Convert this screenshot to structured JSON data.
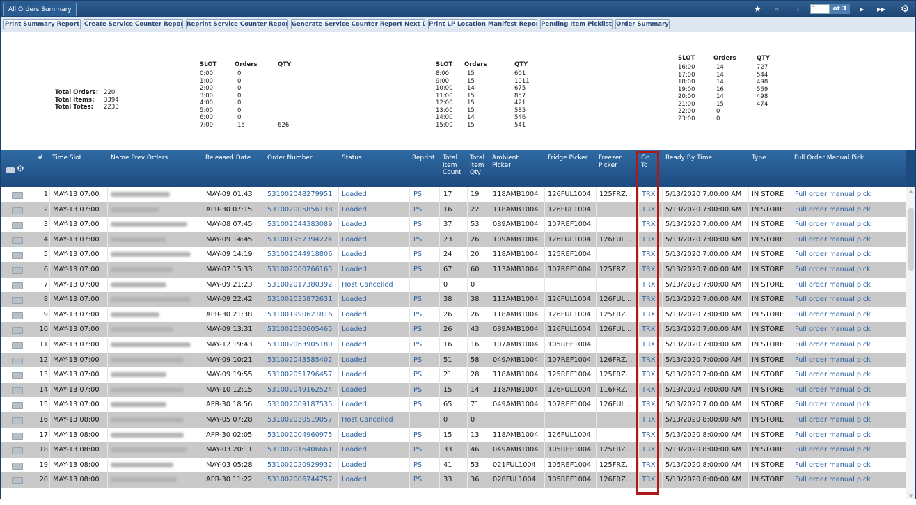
{
  "window": {
    "tab_title": "All Orders Summary"
  },
  "pager": {
    "current_page": "1",
    "of_label": "of 3"
  },
  "toolbar": {
    "buttons": [
      "Print Summary Report",
      "Create Service Counter Report",
      "Reprint Service Counter Report",
      "Generate Service Counter Report Next Day",
      "Print LP Location Manifest Report",
      "Pending Item Picklist",
      "Order Summary"
    ]
  },
  "totals": {
    "orders_label": "Total Orders:",
    "orders": "220",
    "items_label": "Total Items:",
    "items": "3394",
    "totes_label": "Total Totes:",
    "totes": "2233"
  },
  "slot_headers": {
    "slot": "SLOT",
    "orders": "Orders",
    "qty": "QTY"
  },
  "slot_groups": [
    [
      [
        "0:00",
        "0",
        ""
      ],
      [
        "1:00",
        "0",
        ""
      ],
      [
        "2:00",
        "0",
        ""
      ],
      [
        "3:00",
        "0",
        ""
      ],
      [
        "4:00",
        "0",
        ""
      ],
      [
        "5:00",
        "0",
        ""
      ],
      [
        "6:00",
        "0",
        ""
      ],
      [
        "7:00",
        "15",
        "626"
      ]
    ],
    [
      [
        "8:00",
        "15",
        "601"
      ],
      [
        "9:00",
        "15",
        "1011"
      ],
      [
        "10:00",
        "14",
        "675"
      ],
      [
        "11:00",
        "15",
        "857"
      ],
      [
        "12:00",
        "15",
        "421"
      ],
      [
        "13:00",
        "15",
        "585"
      ],
      [
        "14:00",
        "14",
        "546"
      ],
      [
        "15:00",
        "15",
        "541"
      ]
    ],
    [
      [
        "16:00",
        "14",
        "727"
      ],
      [
        "17:00",
        "14",
        "544"
      ],
      [
        "18:00",
        "14",
        "498"
      ],
      [
        "19:00",
        "16",
        "569"
      ],
      [
        "20:00",
        "14",
        "498"
      ],
      [
        "21:00",
        "15",
        "474"
      ],
      [
        "22:00",
        "0",
        ""
      ],
      [
        "23:00",
        "0",
        ""
      ]
    ]
  ],
  "columns": {
    "num": "#",
    "time_slot": "Time Slot",
    "name": "Name Prev Orders",
    "released": "Released Date",
    "order": "Order Number",
    "status": "Status",
    "reprint": "Reprint",
    "total_item_count": "Total Item Count",
    "total_item_qty": "Total Item Qty",
    "ambient": "Ambient Picker",
    "fridge": "Fridge Picker",
    "freezer": "Freezer Picker",
    "goto": "Go To",
    "ready": "Ready By Time",
    "type": "Type",
    "manual": "Full Order Manual Pick"
  },
  "rows": [
    {
      "n": "1",
      "slot": "MAY-13 07:00",
      "rel": "MAY-09 01:43",
      "order": "531002048279951",
      "status": "Loaded",
      "reprint": "PS",
      "count": "17",
      "qty": "19",
      "amb": "118AMB1004",
      "fri": "126FUL1004",
      "fre": "125FRZ...",
      "goto": "TRX",
      "ready": "5/13/2020 7:00:00 AM",
      "type": "IN STORE",
      "manual": "Full order manual pick",
      "bw": 85
    },
    {
      "n": "2",
      "slot": "MAY-13 07:00",
      "rel": "APR-30 07:15",
      "order": "531002005856138",
      "status": "Loaded",
      "reprint": "PS",
      "count": "16",
      "qty": "22",
      "amb": "118AMB1004",
      "fri": "126FUL1004",
      "fre": "",
      "goto": "TRX",
      "ready": "5/13/2020 7:00:00 AM",
      "type": "IN STORE",
      "manual": "Full order manual pick",
      "bw": 70
    },
    {
      "n": "3",
      "slot": "MAY-13 07:00",
      "rel": "MAY-08 07:45",
      "order": "531002044383089",
      "status": "Loaded",
      "reprint": "PS",
      "count": "37",
      "qty": "53",
      "amb": "089AMB1004",
      "fri": "107REF1004",
      "fre": "",
      "goto": "TRX",
      "ready": "5/13/2020 7:00:00 AM",
      "type": "IN STORE",
      "manual": "Full order manual pick",
      "bw": 110
    },
    {
      "n": "4",
      "slot": "MAY-13 07:00",
      "rel": "MAY-09 14:45",
      "order": "531001957394224",
      "status": "Loaded",
      "reprint": "PS",
      "count": "23",
      "qty": "26",
      "amb": "109AMB1004",
      "fri": "126FUL1004",
      "fre": "126FUL...",
      "goto": "TRX",
      "ready": "5/13/2020 7:00:00 AM",
      "type": "IN STORE",
      "manual": "Full order manual pick",
      "bw": 80
    },
    {
      "n": "5",
      "slot": "MAY-13 07:00",
      "rel": "MAY-09 14:19",
      "order": "531002044918806",
      "status": "Loaded",
      "reprint": "PS",
      "count": "24",
      "qty": "20",
      "amb": "118AMB1004",
      "fri": "125REF1004",
      "fre": "",
      "goto": "TRX",
      "ready": "5/13/2020 7:00:00 AM",
      "type": "IN STORE",
      "manual": "Full order manual pick",
      "bw": 115
    },
    {
      "n": "6",
      "slot": "MAY-13 07:00",
      "rel": "MAY-07 15:33",
      "order": "531002000766165",
      "status": "Loaded",
      "reprint": "PS",
      "count": "67",
      "qty": "60",
      "amb": "113AMB1004",
      "fri": "107REF1004",
      "fre": "125FRZ...",
      "goto": "TRX",
      "ready": "5/13/2020 7:00:00 AM",
      "type": "IN STORE",
      "manual": "Full order manual pick",
      "bw": 90
    },
    {
      "n": "7",
      "slot": "MAY-13 07:00",
      "rel": "MAY-09 21:23",
      "order": "531002017380392",
      "status": "Host Cancelled",
      "reprint": "",
      "count": "0",
      "qty": "0",
      "amb": "",
      "fri": "",
      "fre": "",
      "goto": "TRX",
      "ready": "5/13/2020 7:00:00 AM",
      "type": "IN STORE",
      "manual": "Full order manual pick",
      "bw": 80
    },
    {
      "n": "8",
      "slot": "MAY-13 07:00",
      "rel": "MAY-09 22:42",
      "order": "531002035872631",
      "status": "Loaded",
      "reprint": "PS",
      "count": "38",
      "qty": "38",
      "amb": "113AMB1004",
      "fri": "126FUL1004",
      "fre": "126FUL...",
      "goto": "TRX",
      "ready": "5/13/2020 7:00:00 AM",
      "type": "IN STORE",
      "manual": "Full order manual pick",
      "bw": 115
    },
    {
      "n": "9",
      "slot": "MAY-13 07:00",
      "rel": "APR-30 21:38",
      "order": "531001990621816",
      "status": "Loaded",
      "reprint": "PS",
      "count": "26",
      "qty": "26",
      "amb": "118AMB1004",
      "fri": "126FUL1004",
      "fre": "125FRZ...",
      "goto": "TRX",
      "ready": "5/13/2020 7:00:00 AM",
      "type": "IN STORE",
      "manual": "Full order manual pick",
      "bw": 70
    },
    {
      "n": "10",
      "slot": "MAY-13 07:00",
      "rel": "MAY-09 13:31",
      "order": "531002030605465",
      "status": "Loaded",
      "reprint": "PS",
      "count": "26",
      "qty": "43",
      "amb": "089AMB1004",
      "fri": "126FUL1004",
      "fre": "126FUL...",
      "goto": "TRX",
      "ready": "5/13/2020 7:00:00 AM",
      "type": "IN STORE",
      "manual": "Full order manual pick",
      "bw": 90
    },
    {
      "n": "11",
      "slot": "MAY-13 07:00",
      "rel": "MAY-12 19:43",
      "order": "531002063905180",
      "status": "Loaded",
      "reprint": "PS",
      "count": "16",
      "qty": "16",
      "amb": "107AMB1004",
      "fri": "105REF1004",
      "fre": "",
      "goto": "TRX",
      "ready": "5/13/2020 7:00:00 AM",
      "type": "IN STORE",
      "manual": "Full order manual pick",
      "bw": 115
    },
    {
      "n": "12",
      "slot": "MAY-13 07:00",
      "rel": "MAY-09 10:21",
      "order": "531002043585402",
      "status": "Loaded",
      "reprint": "PS",
      "count": "51",
      "qty": "58",
      "amb": "049AMB1004",
      "fri": "107REF1004",
      "fre": "126FRZ...",
      "goto": "TRX",
      "ready": "5/13/2020 7:00:00 AM",
      "type": "IN STORE",
      "manual": "Full order manual pick",
      "bw": 105
    },
    {
      "n": "13",
      "slot": "MAY-13 07:00",
      "rel": "MAY-09 19:55",
      "order": "531002051796457",
      "status": "Loaded",
      "reprint": "PS",
      "count": "21",
      "qty": "28",
      "amb": "118AMB1004",
      "fri": "125REF1004",
      "fre": "125FRZ...",
      "goto": "TRX",
      "ready": "5/13/2020 7:00:00 AM",
      "type": "IN STORE",
      "manual": "Full order manual pick",
      "bw": 80
    },
    {
      "n": "14",
      "slot": "MAY-13 07:00",
      "rel": "MAY-10 12:15",
      "order": "531002049162524",
      "status": "Loaded",
      "reprint": "PS",
      "count": "15",
      "qty": "14",
      "amb": "118AMB1004",
      "fri": "126FUL1004",
      "fre": "116FRZ...",
      "goto": "TRX",
      "ready": "5/13/2020 7:00:00 AM",
      "type": "IN STORE",
      "manual": "Full order manual pick",
      "bw": 105
    },
    {
      "n": "15",
      "slot": "MAY-13 07:00",
      "rel": "APR-30 18:56",
      "order": "531002009187535",
      "status": "Loaded",
      "reprint": "PS",
      "count": "65",
      "qty": "71",
      "amb": "049AMB1004",
      "fri": "107REF1004",
      "fre": "126FUL...",
      "goto": "TRX",
      "ready": "5/13/2020 7:00:00 AM",
      "type": "IN STORE",
      "manual": "Full order manual pick",
      "bw": 80
    },
    {
      "n": "16",
      "slot": "MAY-13 08:00",
      "rel": "MAY-05 07:28",
      "order": "531002030519057",
      "status": "Host Cancelled",
      "reprint": "",
      "count": "0",
      "qty": "0",
      "amb": "",
      "fri": "",
      "fre": "",
      "goto": "TRX",
      "ready": "5/13/2020 8:00:00 AM",
      "type": "IN STORE",
      "manual": "Full order manual pick",
      "bw": 105
    },
    {
      "n": "17",
      "slot": "MAY-13 08:00",
      "rel": "APR-30 02:05",
      "order": "531002004960975",
      "status": "Loaded",
      "reprint": "PS",
      "count": "15",
      "qty": "13",
      "amb": "118AMB1004",
      "fri": "126FUL1004",
      "fre": "",
      "goto": "TRX",
      "ready": "5/13/2020 8:00:00 AM",
      "type": "IN STORE",
      "manual": "Full order manual pick",
      "bw": 105
    },
    {
      "n": "18",
      "slot": "MAY-13 08:00",
      "rel": "MAY-03 20:11",
      "order": "531002016406661",
      "status": "Loaded",
      "reprint": "PS",
      "count": "33",
      "qty": "46",
      "amb": "049AMB1004",
      "fri": "105REF1004",
      "fre": "125FRZ...",
      "goto": "TRX",
      "ready": "5/13/2020 8:00:00 AM",
      "type": "IN STORE",
      "manual": "Full order manual pick",
      "bw": 110
    },
    {
      "n": "19",
      "slot": "MAY-13 08:00",
      "rel": "MAY-03 05:28",
      "order": "531002020929932",
      "status": "Loaded",
      "reprint": "PS",
      "count": "41",
      "qty": "53",
      "amb": "021FUL1004",
      "fri": "105REF1004",
      "fre": "125FRZ...",
      "goto": "TRX",
      "ready": "5/13/2020 8:00:00 AM",
      "type": "IN STORE",
      "manual": "Full order manual pick",
      "bw": 90
    },
    {
      "n": "20",
      "slot": "MAY-13 08:00",
      "rel": "APR-30 11:22",
      "order": "531002006744757",
      "status": "Loaded",
      "reprint": "PS",
      "count": "33",
      "qty": "36",
      "amb": "028FUL1004",
      "fri": "105REF1004",
      "fre": "126FRZ...",
      "goto": "TRX",
      "ready": "5/13/2020 8:00:00 AM",
      "type": "IN STORE",
      "manual": "Full order manual pick",
      "bw": 95
    }
  ],
  "colors": {
    "header": "#1d4b7f",
    "link": "#2d62a0",
    "row_alt": "#c9c9c9",
    "highlight": "#b01818"
  }
}
